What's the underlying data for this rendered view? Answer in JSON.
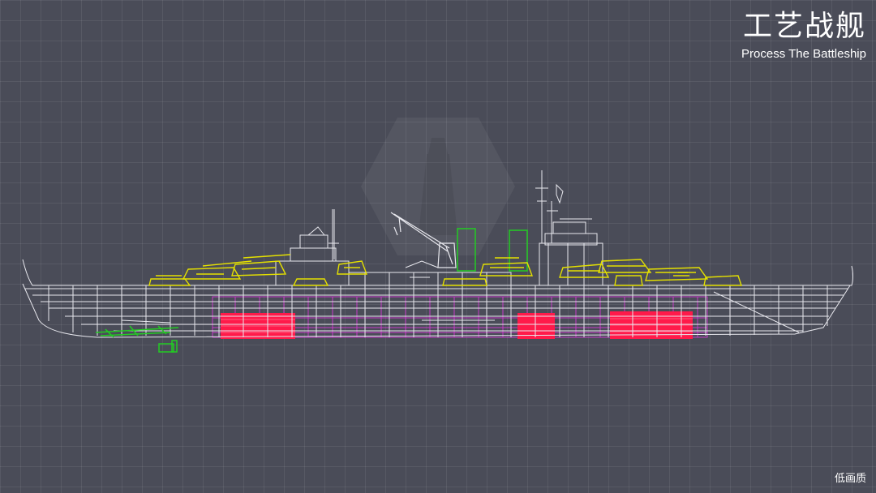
{
  "header": {
    "title_cn": "工艺战舰",
    "title_en": "Process The Battleship"
  },
  "footer": {
    "quality_label": "低画质"
  },
  "colors": {
    "background": "#4a4c58",
    "wireframe": "#e8e8ee",
    "turrets": "#e4e000",
    "magazines": "#ff1a4a",
    "machinery": "#d43cd4",
    "masts": "#22cc22"
  },
  "icons": {
    "watermark": "lighthouse-hexagon-logo"
  }
}
